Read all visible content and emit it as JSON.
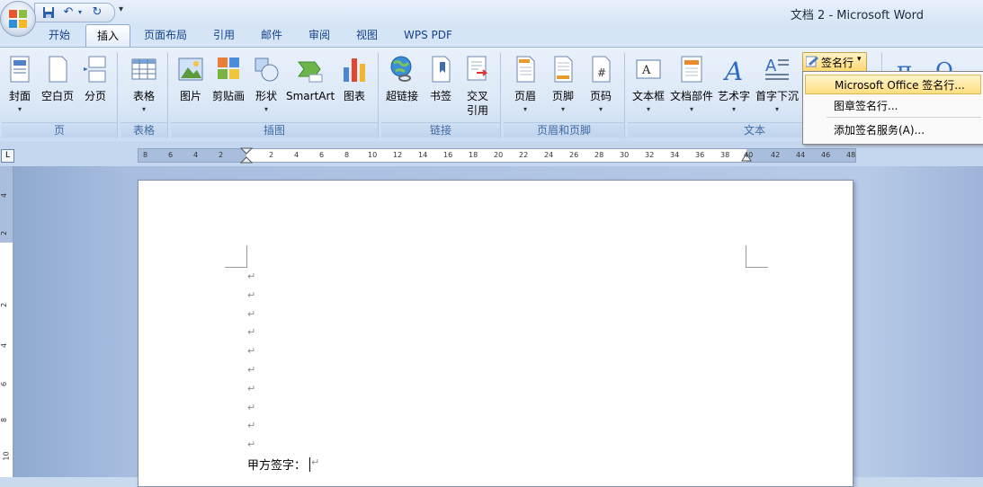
{
  "window": {
    "title": "文档 2 - Microsoft Word"
  },
  "quick_access": {
    "save_icon": "save-icon",
    "undo_label": "↶",
    "redo_label": "↻",
    "more_label": "▾"
  },
  "tabs": [
    {
      "label": "开始",
      "active": false
    },
    {
      "label": "插入",
      "active": true
    },
    {
      "label": "页面布局",
      "active": false
    },
    {
      "label": "引用",
      "active": false
    },
    {
      "label": "邮件",
      "active": false
    },
    {
      "label": "审阅",
      "active": false
    },
    {
      "label": "视图",
      "active": false
    },
    {
      "label": "WPS PDF",
      "active": false
    }
  ],
  "ribbon": {
    "groups": {
      "pages": "页",
      "tables": "表格",
      "illustrations": "插图",
      "links": "链接",
      "header_footer": "页眉和页脚",
      "text": "文本"
    },
    "buttons": {
      "cover": "封面",
      "blank_page": "空白页",
      "page_break": "分页",
      "table": "表格",
      "picture": "图片",
      "clipart": "剪贴画",
      "shapes": "形状",
      "smartart": "SmartArt",
      "chart": "图表",
      "hyperlink": "超链接",
      "bookmark": "书签",
      "cross_ref_1": "交叉",
      "cross_ref_2": "引用",
      "header": "页眉",
      "footer": "页脚",
      "page_number": "页码",
      "textbox": "文本框",
      "quick_parts": "文档部件",
      "wordart": "艺术字",
      "drop_cap": "首字下沉",
      "dropdown_arrow": "▾",
      "signature_line": "签名行"
    }
  },
  "signature_menu": {
    "items": [
      {
        "label": "Microsoft Office 签名行...",
        "highlighted": true
      },
      {
        "label": "图章签名行...",
        "highlighted": false
      },
      {
        "label": "添加签名服务(A)...",
        "highlighted": false
      }
    ]
  },
  "ruler": {
    "corner": "L",
    "ticks": [
      "8",
      "6",
      "4",
      "2",
      "2",
      "4",
      "6",
      "8",
      "10",
      "12",
      "14",
      "16",
      "18",
      "20",
      "22",
      "24",
      "26",
      "28",
      "30",
      "32",
      "34",
      "36",
      "38",
      "40",
      "42",
      "44",
      "46",
      "48"
    ],
    "vticks": [
      "4",
      "2",
      "2",
      "4",
      "6",
      "8",
      "10"
    ]
  },
  "document": {
    "paragraph_mark": "↵",
    "signature_line": "甲方签字："
  },
  "colors": {
    "accent": "#15428b",
    "menu_highlight": "#ffde80",
    "ribbon": "#dde9f7"
  }
}
